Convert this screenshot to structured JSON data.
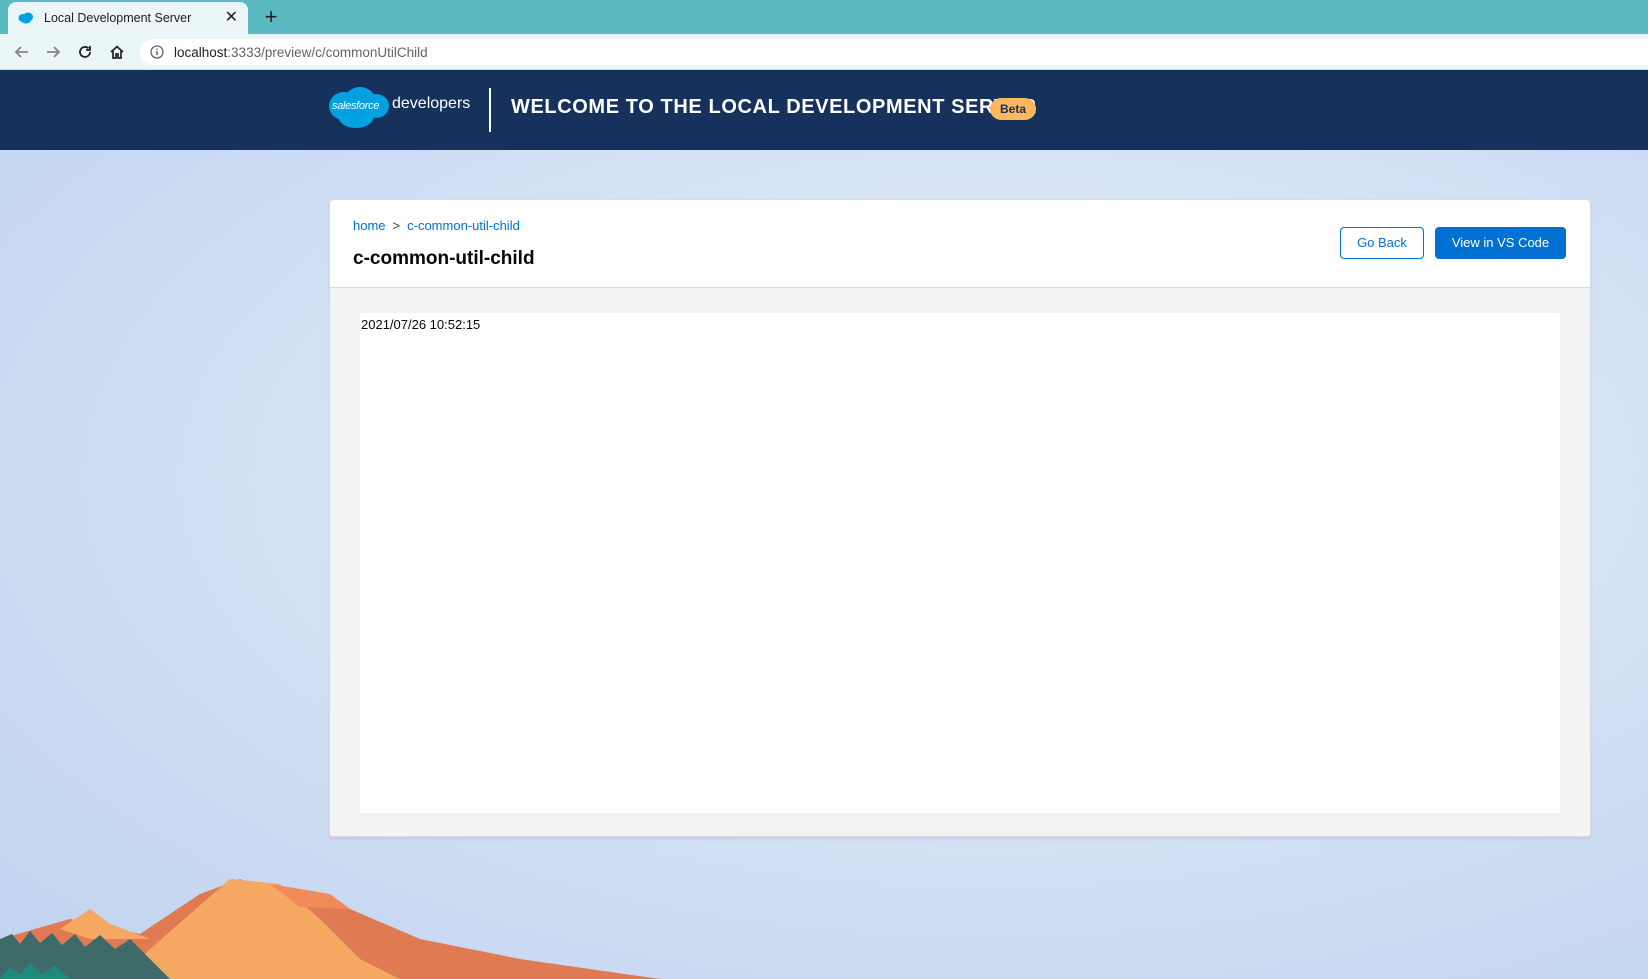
{
  "browser": {
    "tab_title": "Local Development Server",
    "tab_close_glyph": "✕",
    "new_tab_glyph": "+",
    "address_host": "localhost",
    "address_rest": ":3333/preview/c/commonUtilChild",
    "colors": {
      "tabbar": "#5bb9c2",
      "toolbar": "#eaf6f7"
    }
  },
  "header": {
    "logo_cloud_text": "salesforce",
    "logo_text": "developers",
    "welcome": "WELCOME TO THE LOCAL DEVELOPMENT SERVER",
    "beta_badge": "Beta",
    "colors": {
      "background": "#16325c",
      "badge": "#ffb75d"
    }
  },
  "card": {
    "breadcrumb": {
      "home": "home",
      "separator": ">",
      "current": "c-common-util-child"
    },
    "title": "c-common-util-child",
    "go_back_label": "Go Back",
    "vscode_label": "View in VS Code",
    "preview_text": "2021/07/26 10:52:15",
    "colors": {
      "brand": "#0070d2"
    }
  },
  "icons": {
    "back": "arrow-left-icon",
    "forward": "arrow-right-icon",
    "reload": "reload-icon",
    "home": "home-icon",
    "info": "info-icon",
    "favicon": "salesforce-cloud-icon"
  }
}
